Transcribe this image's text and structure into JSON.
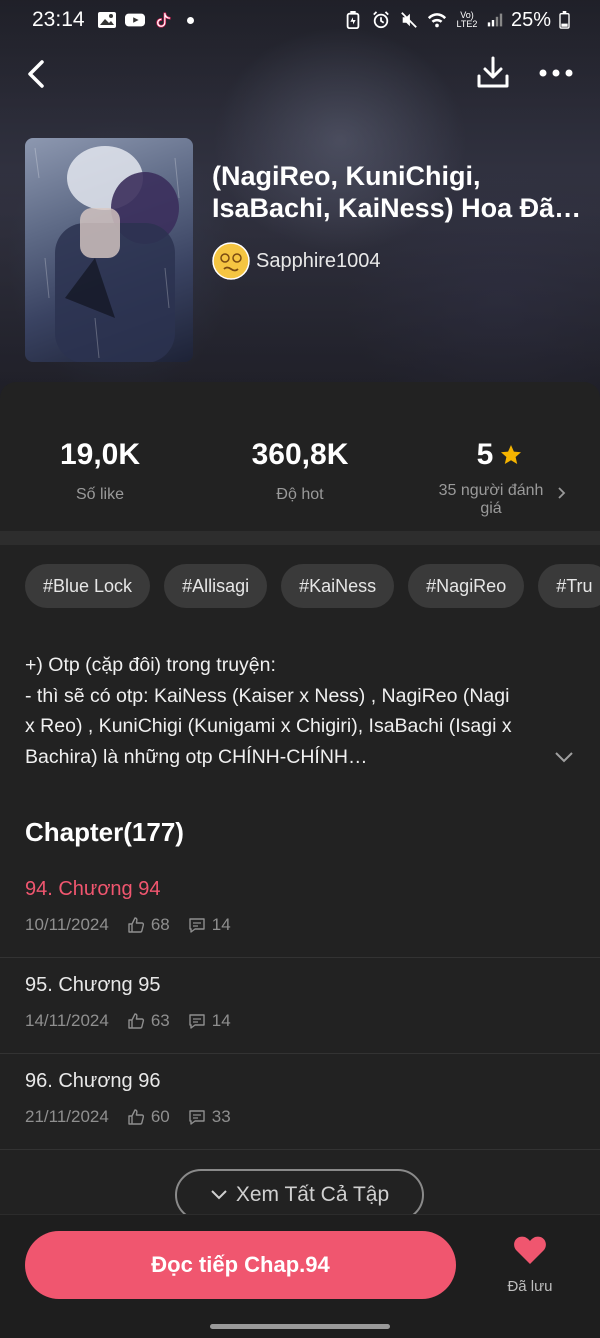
{
  "status_bar": {
    "time": "23:14",
    "battery": "25%",
    "network": "Vo) LTE2"
  },
  "book": {
    "title": "(NagiReo, KuniChigi, IsaBachi, KaiNess) Hoa Đã …",
    "author": "Sapphire1004"
  },
  "stats": {
    "likes": {
      "value": "19,0K",
      "label": "Số like"
    },
    "hot": {
      "value": "360,8K",
      "label": "Độ hot"
    },
    "rating": {
      "value": "5",
      "label": "35 người đánh giá"
    }
  },
  "tags": [
    "#Blue Lock",
    "#Allisagi",
    "#KaiNess",
    "#NagiReo",
    "#Tru"
  ],
  "description": {
    "lines": [
      "+) Otp (cặp đôi) trong truyện:",
      "- thì sẽ có otp: KaiNess (Kaiser x Ness) , NagiReo (Nagi",
      "x Reo) , KuniChigi (Kunigami x Chigiri), IsaBachi (Isagi x",
      "Bachira) là những otp CHÍNH-CHÍNH…"
    ]
  },
  "chapters_header": "Chapter(177)",
  "chapters": [
    {
      "title": "94. Chương 94",
      "date": "10/11/2024",
      "likes": "68",
      "comments": "14",
      "current": true
    },
    {
      "title": "95. Chương 95",
      "date": "14/11/2024",
      "likes": "63",
      "comments": "14",
      "current": false
    },
    {
      "title": "96. Chương 96",
      "date": "21/11/2024",
      "likes": "60",
      "comments": "33",
      "current": false
    }
  ],
  "see_all_label": "Xem Tất Cả Tập",
  "read_button_label": "Đọc tiếp Chap.94",
  "save_label": "Đã lưu",
  "colors": {
    "accent": "#f0566f",
    "star": "#f5b400",
    "background": "#222222"
  }
}
